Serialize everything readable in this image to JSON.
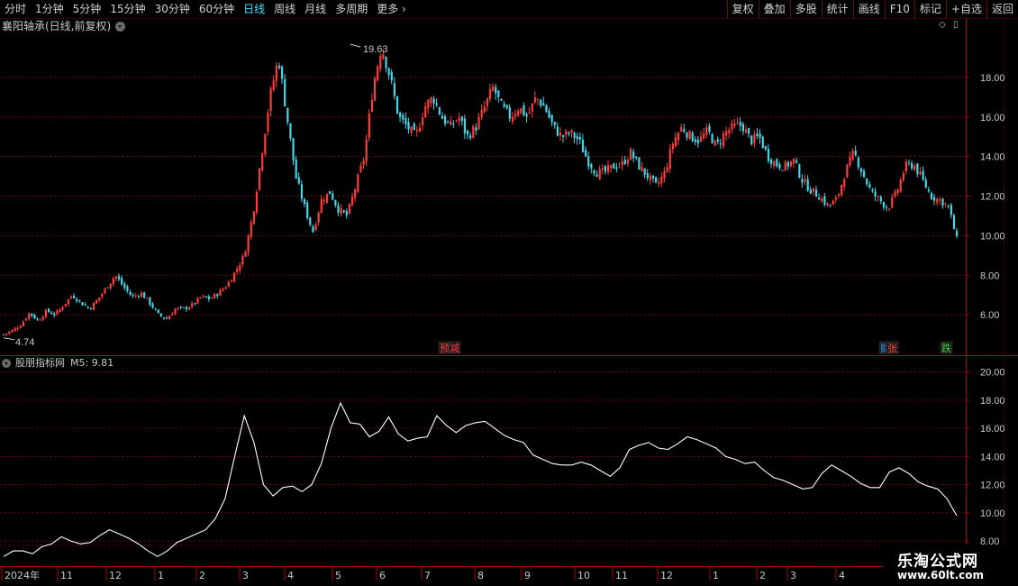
{
  "toolbar": {
    "periods": [
      "分时",
      "1分钟",
      "5分钟",
      "15分钟",
      "30分钟",
      "60分钟",
      "日线",
      "周线",
      "月线",
      "多周期",
      "更多"
    ],
    "active_period": "日线",
    "more_chevron": "›",
    "actions": [
      "复权",
      "叠加",
      "多股",
      "统计",
      "画线",
      "F10",
      "标记",
      "+自选",
      "返回"
    ]
  },
  "main_chart": {
    "title": "襄阳轴承(日线,前复权)",
    "yticks": [
      "18.00",
      "16.00",
      "14.00",
      "12.00",
      "10.00",
      "8.00",
      "6.00"
    ],
    "high_label": "19.63",
    "low_label": "4.74",
    "markers": [
      {
        "text": "预减",
        "color": "#ff4040"
      },
      {
        "text": "财",
        "color": "#40a0ff"
      },
      {
        "text": "张",
        "color": "#ff4040"
      },
      {
        "text": "跌",
        "color": "#40d040"
      }
    ]
  },
  "indicator": {
    "name": "股朋指标网",
    "label": "M5: 9.81",
    "yticks": [
      "20.00",
      "18.00",
      "16.00",
      "14.00",
      "12.00",
      "10.00",
      "8.00"
    ]
  },
  "x_axis": {
    "labels": [
      "2024年",
      "11",
      "12",
      "1",
      "2",
      "3",
      "4",
      "5",
      "6",
      "7",
      "8",
      "9",
      "10",
      "11",
      "12",
      "1",
      "2",
      "3",
      "4"
    ]
  },
  "watermark": {
    "line1": "乐淘公式网",
    "line2": "www.60lt.com"
  },
  "colors": {
    "up": "#ff3c3c",
    "down": "#40d8e8",
    "grid": "#7a0000",
    "axis": "#b00000",
    "line": "#ffffff",
    "active": "#44e0ff"
  },
  "chart_data": {
    "type": "candlestick",
    "price_range": [
      4.0,
      20.0
    ],
    "indicator_range": [
      6.6,
      21.0
    ],
    "close_series": [
      5.0,
      5.2,
      5.5,
      6.1,
      5.7,
      6.2,
      6.0,
      6.5,
      7.0,
      6.6,
      6.3,
      6.8,
      7.4,
      8.0,
      7.4,
      6.9,
      7.1,
      6.6,
      6.0,
      5.8,
      6.3,
      6.3,
      6.5,
      6.9,
      6.8,
      7.1,
      7.5,
      8.2,
      9.0,
      11.0,
      14.0,
      17.0,
      19.0,
      16.0,
      13.0,
      11.5,
      10.2,
      11.8,
      12.2,
      11.3,
      11.0,
      12.5,
      14.0,
      17.5,
      19.6,
      18.0,
      16.0,
      15.5,
      15.0,
      16.5,
      17.0,
      16.0,
      15.5,
      16.0,
      15.0,
      15.5,
      16.5,
      17.5,
      16.5,
      16.0,
      16.5,
      16.0,
      17.0,
      16.5,
      15.5,
      15.0,
      15.2,
      14.8,
      13.8,
      13.2,
      13.2,
      13.5,
      13.6,
      14.2,
      13.5,
      13.0,
      12.5,
      13.2,
      14.8,
      15.5,
      15.0,
      14.8,
      15.3,
      14.5,
      15.2,
      15.5,
      15.6,
      14.8,
      15.0,
      14.0,
      13.6,
      13.5,
      13.8,
      12.8,
      12.3,
      12.0,
      11.5,
      11.8,
      13.2,
      14.2,
      13.2,
      12.2,
      11.8,
      11.4,
      12.2,
      13.5,
      13.6,
      12.8,
      12.0,
      11.8,
      11.5,
      9.8
    ],
    "indicator_series": [
      6.9,
      7.3,
      7.3,
      7.1,
      7.6,
      7.8,
      8.3,
      8.0,
      7.8,
      7.9,
      8.4,
      8.8,
      8.5,
      8.2,
      7.8,
      7.3,
      6.9,
      7.3,
      7.9,
      8.2,
      8.5,
      8.8,
      9.6,
      11.0,
      14.0,
      16.9,
      15.0,
      12.0,
      11.2,
      11.8,
      11.9,
      11.5,
      12.0,
      13.5,
      16.0,
      17.8,
      16.4,
      16.3,
      15.4,
      15.8,
      16.8,
      15.6,
      15.1,
      15.3,
      15.4,
      16.9,
      16.2,
      15.7,
      16.2,
      16.4,
      16.5,
      16.0,
      15.5,
      15.2,
      15.0,
      14.1,
      13.8,
      13.5,
      13.4,
      13.4,
      13.6,
      13.4,
      13.0,
      12.6,
      13.2,
      14.5,
      14.8,
      15.0,
      14.6,
      14.5,
      14.9,
      15.4,
      15.2,
      14.9,
      14.6,
      14.0,
      13.8,
      13.5,
      13.6,
      13.0,
      12.5,
      12.3,
      12.0,
      11.7,
      11.8,
      12.8,
      13.4,
      13.0,
      12.6,
      12.1,
      11.8,
      11.8,
      12.9,
      13.2,
      12.8,
      12.2,
      11.9,
      11.7,
      11.0,
      9.8
    ]
  }
}
